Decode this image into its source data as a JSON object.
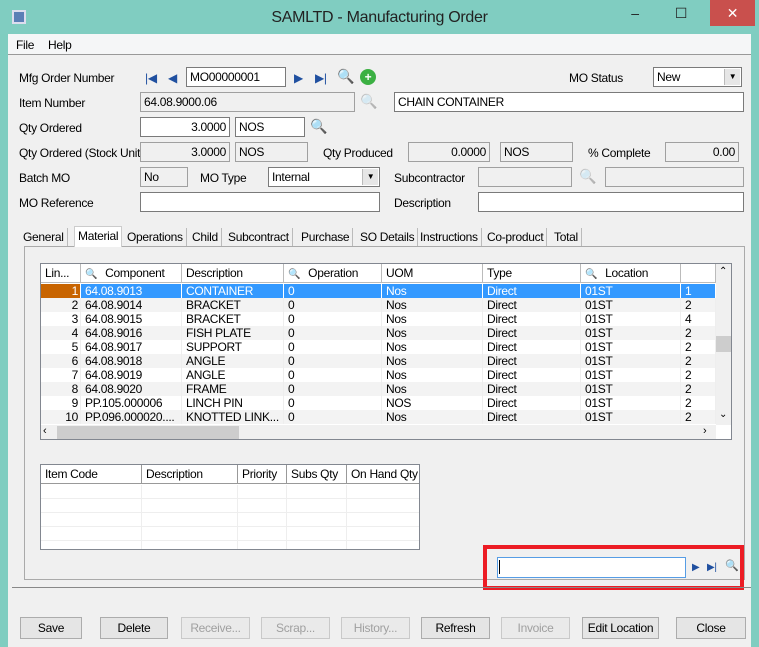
{
  "window": {
    "title": "SAMLTD -  Manufacturing Order",
    "minimize": "‒",
    "maximize": "☐",
    "close": "✕"
  },
  "menu": [
    "File",
    "Help"
  ],
  "form": {
    "mfg_order_label": "Mfg Order Number",
    "mfg_order_value": "MO00000001",
    "mo_status_label": "MO Status",
    "mo_status_value": "New",
    "item_number_label": "Item Number",
    "item_number_value": "64.08.9000.06",
    "item_description": "CHAIN CONTAINER",
    "qty_ordered_label": "Qty Ordered",
    "qty_ordered_value": "3.0000",
    "qty_ordered_uom": "NOS",
    "qty_stock_label": "Qty Ordered (Stock Unit)",
    "qty_stock_value": "3.0000",
    "qty_stock_uom": "NOS",
    "qty_produced_label": "Qty Produced",
    "qty_produced_value": "0.0000",
    "qty_produced_uom": "NOS",
    "pct_complete_label": "% Complete",
    "pct_complete_value": "0.00",
    "batch_mo_label": "Batch MO",
    "batch_mo_value": "No",
    "mo_type_label": "MO Type",
    "mo_type_value": "Internal",
    "subcontractor_label": "Subcontractor",
    "subcontractor_value": "",
    "subcontractor_name": "",
    "mo_reference_label": "MO Reference",
    "mo_reference_value": "",
    "description_label": "Description",
    "description_value": ""
  },
  "tabs": [
    "General",
    "Material",
    "Operations",
    "Child",
    "Subcontract",
    "Purchase",
    "SO Details",
    "Instructions",
    "Co-product",
    "Total"
  ],
  "active_tab": "Material",
  "material_grid": {
    "columns": [
      "Lin...",
      "Component",
      "Description",
      "Operation",
      "UOM",
      "Type",
      "Location",
      ""
    ],
    "rows": [
      [
        "1",
        "64.08.9013",
        "CONTAINER",
        "0",
        "Nos",
        "Direct",
        "01ST",
        "1"
      ],
      [
        "2",
        "64.08.9014",
        "BRACKET",
        "0",
        "Nos",
        "Direct",
        "01ST",
        "2"
      ],
      [
        "3",
        "64.08.9015",
        "BRACKET",
        "0",
        "Nos",
        "Direct",
        "01ST",
        "4"
      ],
      [
        "4",
        "64.08.9016",
        "FISH PLATE",
        "0",
        "Nos",
        "Direct",
        "01ST",
        "2"
      ],
      [
        "5",
        "64.08.9017",
        "SUPPORT",
        "0",
        "Nos",
        "Direct",
        "01ST",
        "2"
      ],
      [
        "6",
        "64.08.9018",
        "ANGLE",
        "0",
        "Nos",
        "Direct",
        "01ST",
        "2"
      ],
      [
        "7",
        "64.08.9019",
        "ANGLE",
        "0",
        "Nos",
        "Direct",
        "01ST",
        "2"
      ],
      [
        "8",
        "64.08.9020",
        "FRAME",
        "0",
        "Nos",
        "Direct",
        "01ST",
        "2"
      ],
      [
        "9",
        "PP.105.000006",
        "LINCH PIN",
        "0",
        "NOS",
        "Direct",
        "01ST",
        "2"
      ],
      [
        "10",
        "PP.096.000020....",
        "KNOTTED LINK...",
        "0",
        "Nos",
        "Direct",
        "01ST",
        "2"
      ]
    ]
  },
  "subs_grid": {
    "columns": [
      "Item Code",
      "Description",
      "Priority",
      "Subs Qty",
      "On Hand Qty"
    ]
  },
  "search_box": {
    "value": ""
  },
  "buttons": [
    {
      "label": "Save",
      "enabled": true
    },
    {
      "label": "Delete",
      "enabled": true
    },
    {
      "label": "Receive...",
      "enabled": false
    },
    {
      "label": "Scrap...",
      "enabled": false
    },
    {
      "label": "History...",
      "enabled": false
    },
    {
      "label": "Refresh",
      "enabled": true
    },
    {
      "label": "Invoice",
      "enabled": false
    },
    {
      "label": "Edit Location",
      "enabled": true
    },
    {
      "label": "Close",
      "enabled": true
    }
  ],
  "colors": {
    "titlebar": "#80cdc1",
    "selection": "#3399ff",
    "highlight_box": "#ec1c24",
    "close": "#c9504d"
  }
}
